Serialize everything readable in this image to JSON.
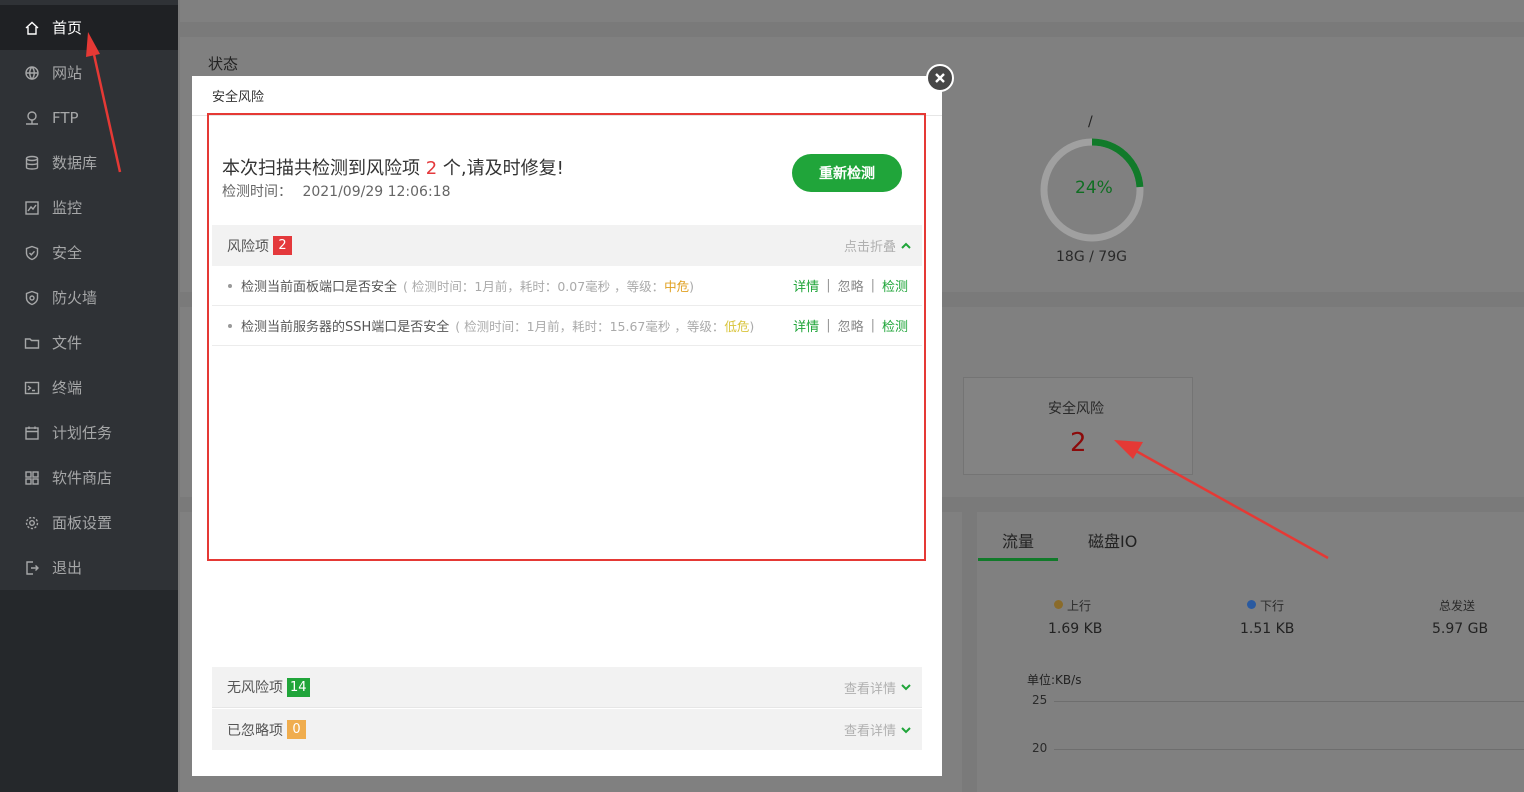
{
  "sidebar": {
    "items": [
      {
        "label": "首页",
        "icon": "home-icon",
        "active": true
      },
      {
        "label": "网站",
        "icon": "globe-icon"
      },
      {
        "label": "FTP",
        "icon": "ftp-icon"
      },
      {
        "label": "数据库",
        "icon": "database-icon"
      },
      {
        "label": "监控",
        "icon": "monitor-icon"
      },
      {
        "label": "安全",
        "icon": "shield-icon"
      },
      {
        "label": "防火墙",
        "icon": "firewall-icon"
      },
      {
        "label": "文件",
        "icon": "folder-icon"
      },
      {
        "label": "终端",
        "icon": "terminal-icon"
      },
      {
        "label": "计划任务",
        "icon": "calendar-icon"
      },
      {
        "label": "软件商店",
        "icon": "grid-icon"
      },
      {
        "label": "面板设置",
        "icon": "gear-icon"
      },
      {
        "label": "退出",
        "icon": "logout-icon"
      }
    ]
  },
  "dashboard": {
    "status_title": "状态",
    "disk": {
      "mount": "/",
      "percent": "24%",
      "percent_value": 0.24,
      "usage": "18G / 79G"
    },
    "security_risk": {
      "label": "安全风险",
      "count": "2"
    },
    "traffic_tabs": {
      "tab1": "流量",
      "tab2": "磁盘IO"
    },
    "traffic": {
      "up_label": "上行",
      "up_value": "1.69 KB",
      "down_label": "下行",
      "down_value": "1.51 KB",
      "total_label": "总发送",
      "total_value": "5.97 GB",
      "unit": "单位:KB/s",
      "y_ticks": [
        "25",
        "20"
      ]
    }
  },
  "modal": {
    "title": "安全风险",
    "scan_prefix": "本次扫描共检测到风险项",
    "scan_count": "2",
    "scan_suffix": "个,请及时修复!",
    "scan_time_label": "检测时间：",
    "scan_time": "2021/09/29 12:06:18",
    "rescan_button": "重新检测",
    "risk_group": {
      "label": "风险项",
      "count": "2",
      "toggle": "点击折叠"
    },
    "risks": [
      {
        "name": "检测当前面板端口是否安全",
        "meta_prefix": "( 检测时间：1月前，耗时：0.07毫秒 ，等级：",
        "level": "中危",
        "meta_suffix": ")",
        "detail": "详情",
        "ignore": "忽略",
        "check": "检测"
      },
      {
        "name": "检测当前服务器的SSH端口是否安全",
        "meta_prefix": "( 检测时间：1月前，耗时：15.67毫秒 ，等级：",
        "level": "低危",
        "meta_suffix": ")",
        "detail": "详情",
        "ignore": "忽略",
        "check": "检测"
      }
    ],
    "safe_group": {
      "label": "无风险项",
      "count": "14",
      "toggle": "查看详情"
    },
    "ignored_group": {
      "label": "已忽略项",
      "count": "0",
      "toggle": "查看详情"
    }
  },
  "colors": {
    "brand_green": "#20a53a",
    "risk_red": "#e4393c",
    "annotation_red": "#e53935"
  }
}
